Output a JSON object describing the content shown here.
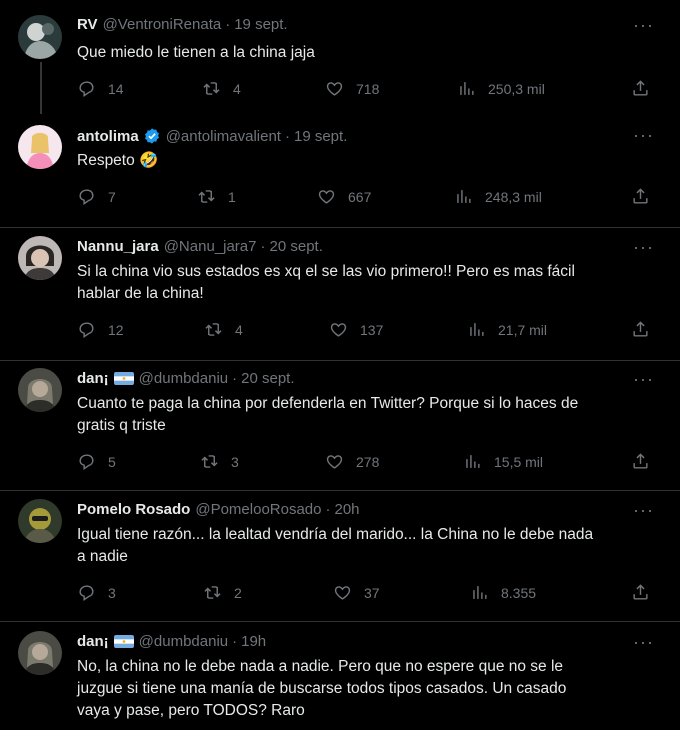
{
  "tweets": [
    {
      "name": "RV",
      "handle": "@VentroniRenata",
      "date": "19 sept.",
      "text": "Que miedo le tienen a la china jaja",
      "replies": "14",
      "retweets": "4",
      "likes": "718",
      "views": "250,3 mil",
      "avatar_color": "#3a4a4c",
      "has_flag": false,
      "verified": false
    },
    {
      "name": "antolima",
      "handle": "@antolimavalient",
      "date": "19 sept.",
      "text": "Respeto 🤣",
      "replies": "7",
      "retweets": "1",
      "likes": "667",
      "views": "248,3 mil",
      "avatar_color": "#f4a9c3",
      "has_flag": false,
      "verified": true
    },
    {
      "name": "Nannu_jara",
      "handle": "@Nanu_jara7",
      "date": "20 sept.",
      "text_lines": [
        "Si la china vio sus estados es xq el se las vio primero!! Pero es mas fácil",
        "hablar de la china!"
      ],
      "replies": "12",
      "retweets": "4",
      "likes": "137",
      "views": "21,7 mil",
      "avatar_color": "#8a8583",
      "has_flag": false,
      "verified": false
    },
    {
      "name": "dan¡",
      "handle": "@dumbdaniu",
      "date": "20 sept.",
      "text_lines": [
        "Cuanto te paga la china por defenderla en Twitter? Porque si lo haces de",
        "gratis q triste"
      ],
      "replies": "5",
      "retweets": "3",
      "likes": "278",
      "views": "15,5 mil",
      "avatar_color": "#5b5c55",
      "has_flag": true,
      "verified": false
    },
    {
      "name": "Pomelo Rosado",
      "handle": "@PomelooRosado",
      "date": "20h",
      "text_lines": [
        "Igual tiene razón... la lealtad vendría del marido... la China no le debe nada",
        "a nadie"
      ],
      "replies": "3",
      "retweets": "2",
      "likes": "37",
      "views": "8.355",
      "avatar_color": "#6a6630",
      "has_flag": false,
      "verified": false
    },
    {
      "name": "dan¡",
      "handle": "@dumbdaniu",
      "date": "19h",
      "text_lines": [
        "No, la china no le debe nada a nadie. Pero que no espere que no se le",
        "juzgue si tiene una manía de buscarse todos tipos casados. Un casado",
        "vaya y pase, pero TODOS? Raro"
      ],
      "avatar_color": "#5b5c55",
      "has_flag": true,
      "verified": false
    }
  ],
  "ui": {
    "more_label": "···",
    "accent": "#1d9bf0",
    "icons": [
      "reply-icon",
      "retweet-icon",
      "like-icon",
      "views-icon",
      "share-icon",
      "verified-icon",
      "argentina-flag-icon",
      "more-icon"
    ]
  }
}
